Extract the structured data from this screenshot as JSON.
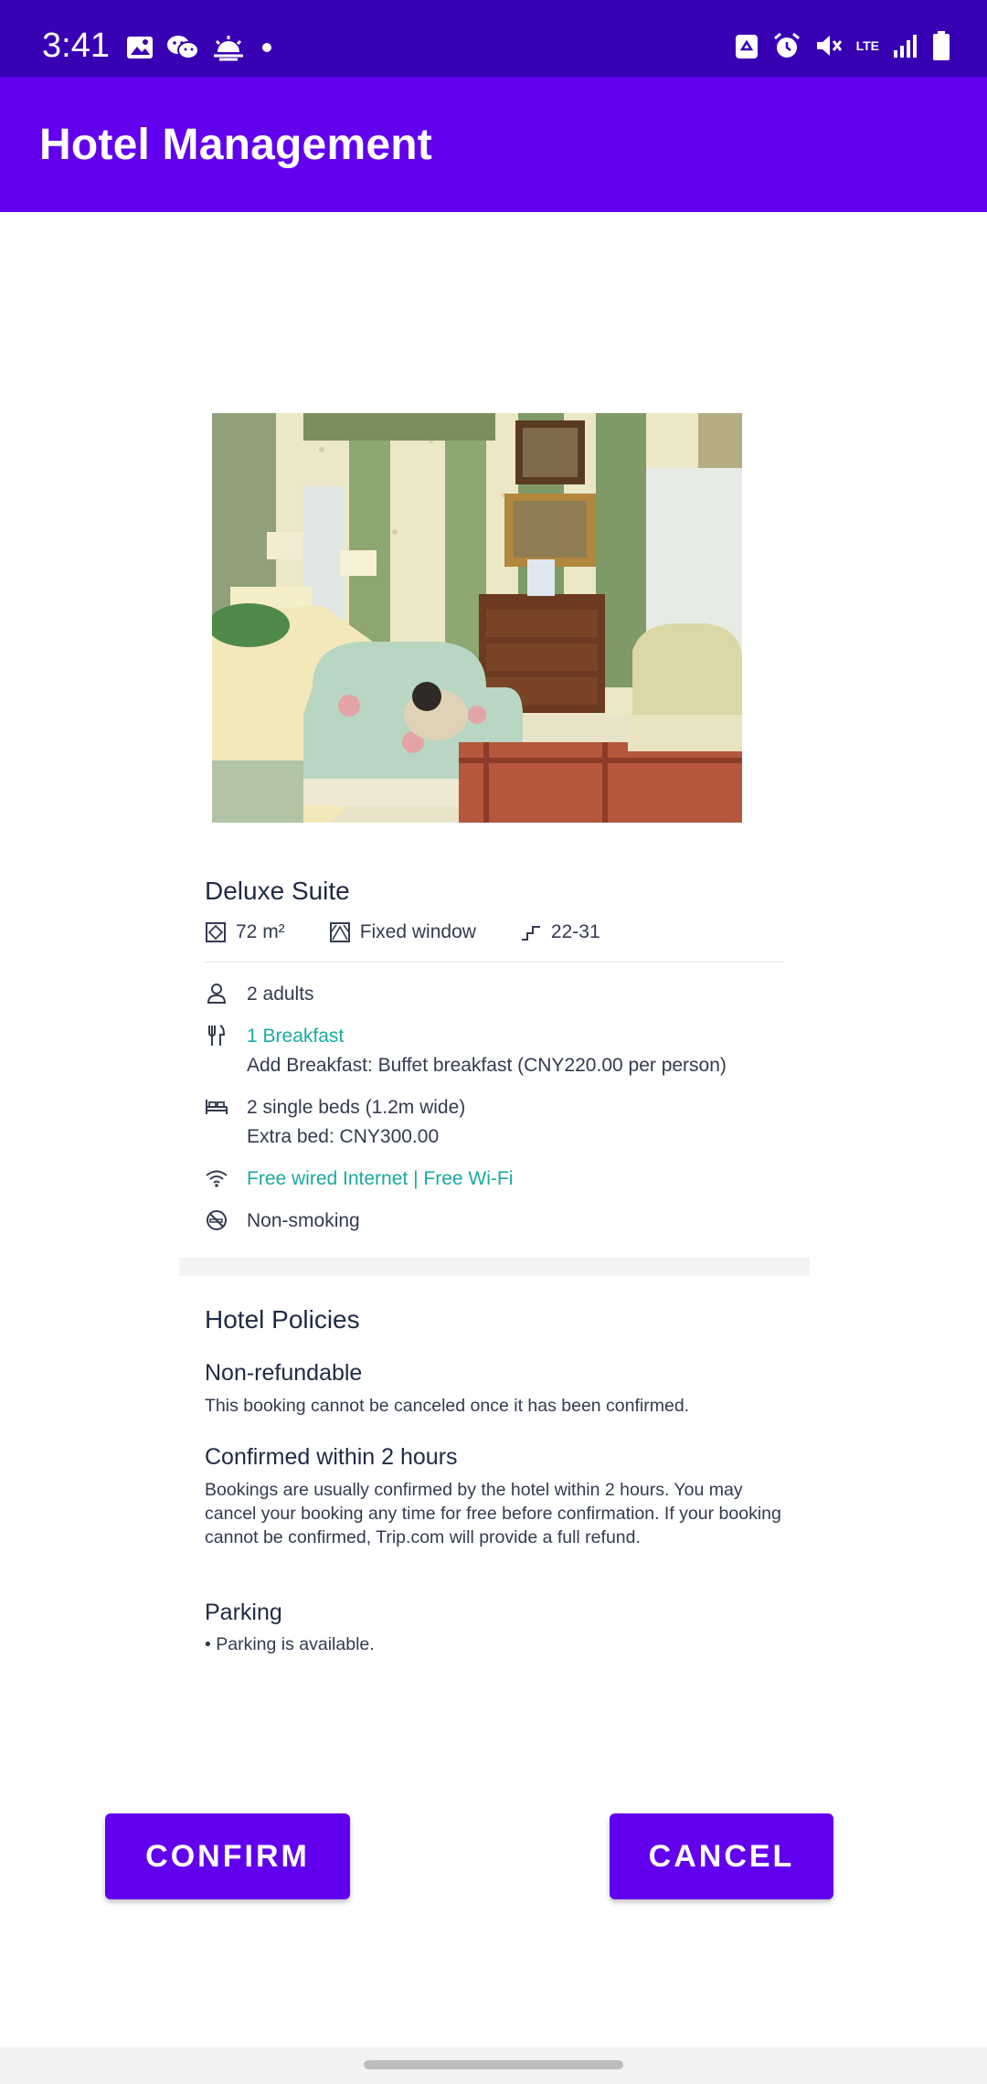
{
  "status_bar": {
    "time": "3:41",
    "network": "LTE",
    "left_icons": [
      "gallery-icon",
      "wechat-icon",
      "weather-icon",
      "dot-icon"
    ],
    "right_icons": [
      "recycle-icon",
      "alarm-icon",
      "mute-icon",
      "lte-icon",
      "signal-icon",
      "battery-icon"
    ]
  },
  "app_bar": {
    "title": "Hotel Management"
  },
  "room": {
    "name": "Deluxe Suite",
    "size": "72 m²",
    "window": "Fixed window",
    "floors": "22-31"
  },
  "amenities": {
    "occupancy": "2 adults",
    "breakfast": "1 Breakfast",
    "breakfast_add": "Add Breakfast: Buffet breakfast (CNY220.00 per person)",
    "beds": "2 single beds (1.2m wide)",
    "extra_bed": "Extra bed: CNY300.00",
    "internet": "Free wired Internet | Free Wi-Fi",
    "smoking": "Non-smoking"
  },
  "policies": {
    "title": "Hotel Policies",
    "items": [
      {
        "heading": "Non-refundable",
        "body": "This booking cannot be canceled once it has been confirmed."
      },
      {
        "heading": "Confirmed within 2 hours",
        "body": "Bookings are usually confirmed by the hotel within 2 hours. You may cancel your booking any time for free before confirmation. If your booking cannot be confirmed, Trip.com will provide a full refund."
      },
      {
        "heading": "Parking",
        "body": "• Parking is available."
      }
    ]
  },
  "actions": {
    "confirm": "CONFIRM",
    "cancel": "CANCEL"
  },
  "colors": {
    "status_bar": "#3700b3",
    "primary": "#6200ee",
    "teal": "#1aa9a2",
    "text": "#1f2a44"
  }
}
